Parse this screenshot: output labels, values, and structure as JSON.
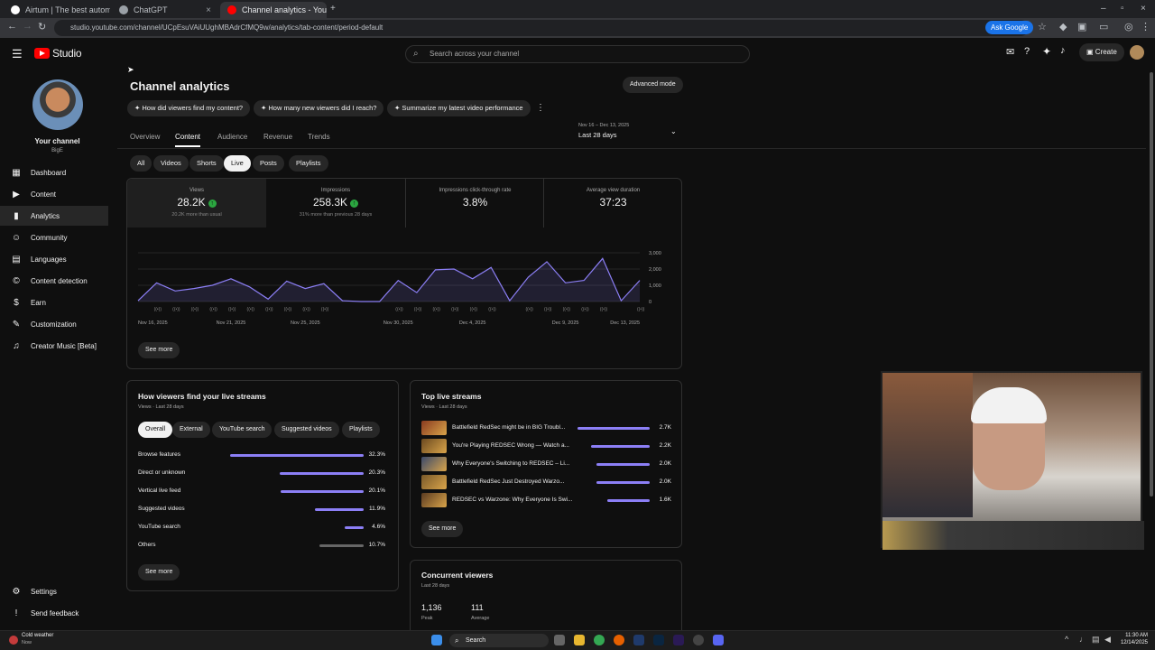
{
  "browser": {
    "tabs": [
      {
        "label": "Airtum | The best automation t",
        "color": "#ffffff"
      },
      {
        "label": "ChatGPT",
        "color": "#9aa0a6"
      },
      {
        "label": "Channel analytics - YouTube St",
        "color": "#ff0000"
      }
    ],
    "url": "studio.youtube.com/channel/UCpEsuVAiUUghMBAdrCfMQ9w/analytics/tab-content/period-default",
    "ask_google": "Ask Google"
  },
  "header": {
    "logo_text": "Studio",
    "search_placeholder": "Search across your channel",
    "create_label": "Create"
  },
  "sidebar": {
    "channel_title": "Your channel",
    "channel_name": "BigE",
    "items": [
      {
        "label": "Dashboard",
        "icon": "dashboard-icon"
      },
      {
        "label": "Content",
        "icon": "content-icon"
      },
      {
        "label": "Analytics",
        "icon": "analytics-icon"
      },
      {
        "label": "Community",
        "icon": "community-icon"
      },
      {
        "label": "Languages",
        "icon": "languages-icon"
      },
      {
        "label": "Content detection",
        "icon": "copyright-icon"
      },
      {
        "label": "Earn",
        "icon": "earn-icon"
      },
      {
        "label": "Customization",
        "icon": "customization-icon"
      },
      {
        "label": "Creator Music [Beta]",
        "icon": "music-icon"
      }
    ],
    "settings": "Settings",
    "feedback": "Send feedback"
  },
  "page": {
    "title": "Channel analytics",
    "advanced_mode": "Advanced mode",
    "suggestions": [
      "How did viewers find my content?",
      "How many new viewers did I reach?",
      "Summarize my latest video performance"
    ],
    "tabs": [
      "Overview",
      "Content",
      "Audience",
      "Revenue",
      "Trends"
    ],
    "active_tab": "Content",
    "date_range_dates": "Nov 16 – Dec 13, 2025",
    "date_range_label": "Last 28 days",
    "filters": [
      "All",
      "Videos",
      "Shorts",
      "Live",
      "Posts",
      "Playlists"
    ],
    "active_filter": "Live"
  },
  "kpis": [
    {
      "label": "Views",
      "value": "28.2K",
      "sub": "20.2K more than usual",
      "up": true
    },
    {
      "label": "Impressions",
      "value": "258.3K",
      "sub": "31% more than previous 28 days",
      "up": true
    },
    {
      "label": "Impressions click-through rate",
      "value": "3.8%",
      "sub": "",
      "up": false
    },
    {
      "label": "Average view duration",
      "value": "37:23",
      "sub": "",
      "up": false
    }
  ],
  "chart_data": {
    "type": "line",
    "x": [
      "Nov 16",
      "Nov 17",
      "Nov 18",
      "Nov 19",
      "Nov 20",
      "Nov 21",
      "Nov 22",
      "Nov 23",
      "Nov 24",
      "Nov 25",
      "Nov 26",
      "Nov 27",
      "Nov 28",
      "Nov 29",
      "Nov 30",
      "Dec 1",
      "Dec 2",
      "Dec 3",
      "Dec 4",
      "Dec 5",
      "Dec 6",
      "Dec 7",
      "Dec 8",
      "Dec 9",
      "Dec 10",
      "Dec 11",
      "Dec 12",
      "Dec 13"
    ],
    "values": [
      50,
      1150,
      650,
      800,
      1000,
      1400,
      900,
      150,
      1250,
      800,
      1100,
      50,
      0,
      0,
      1300,
      550,
      1950,
      2000,
      1400,
      2100,
      50,
      1500,
      2450,
      1150,
      1300,
      2650,
      50,
      1300
    ],
    "x_ticks": [
      "Nov 16, 2025",
      "Nov 21, 2025",
      "Nov 25, 2025",
      "Nov 30, 2025",
      "Dec 4, 2025",
      "Dec 9, 2025",
      "Dec 13, 2025"
    ],
    "y_ticks": [
      "3,000",
      "2,000",
      "1,000",
      "0"
    ],
    "ylim": [
      0,
      3000
    ],
    "color": "#8c7ff6"
  },
  "chart_see_more": "See more",
  "traffic": {
    "title": "How viewers find your live streams",
    "subtitle": "Views · Last 28 days",
    "tabs": [
      "Overall",
      "External",
      "YouTube search",
      "Suggested videos",
      "Playlists"
    ],
    "rows": [
      {
        "label": "Browse features",
        "pct": "32.3%",
        "value": 0.323,
        "grey": false
      },
      {
        "label": "Direct or unknown",
        "pct": "20.3%",
        "value": 0.203,
        "grey": false
      },
      {
        "label": "Vertical live feed",
        "pct": "20.1%",
        "value": 0.201,
        "grey": false
      },
      {
        "label": "Suggested videos",
        "pct": "11.9%",
        "value": 0.119,
        "grey": false
      },
      {
        "label": "YouTube search",
        "pct": "4.6%",
        "value": 0.046,
        "grey": false
      },
      {
        "label": "Others",
        "pct": "10.7%",
        "value": 0.107,
        "grey": true
      }
    ],
    "see_more": "See more"
  },
  "top_streams": {
    "title": "Top live streams",
    "subtitle": "Views · Last 28 days",
    "rows": [
      {
        "title": "Battlefield RedSec might be in BIG Troubl...",
        "views": "2.7K",
        "value": 2700
      },
      {
        "title": "You're Playing REDSEC Wrong — Watch a...",
        "views": "2.2K",
        "value": 2200
      },
      {
        "title": "Why Everyone's Switching to REDSEC – Li...",
        "views": "2.0K",
        "value": 2000
      },
      {
        "title": "Battlefield RedSec Just Destroyed Warzo...",
        "views": "2.0K",
        "value": 2000
      },
      {
        "title": "REDSEC vs Warzone: Why Everyone Is Swi...",
        "views": "1.6K",
        "value": 1600
      }
    ],
    "see_more": "See more"
  },
  "concurrent": {
    "title": "Concurrent viewers",
    "subtitle": "Last 28 days",
    "peak_value": "1,136",
    "peak_label": "Peak",
    "avg_value": "111",
    "avg_label": "Average"
  },
  "taskbar": {
    "weather_title": "Cold weather",
    "weather_sub": "Now",
    "search": "Search",
    "time": "11:30 AM",
    "date": "12/14/2025"
  }
}
